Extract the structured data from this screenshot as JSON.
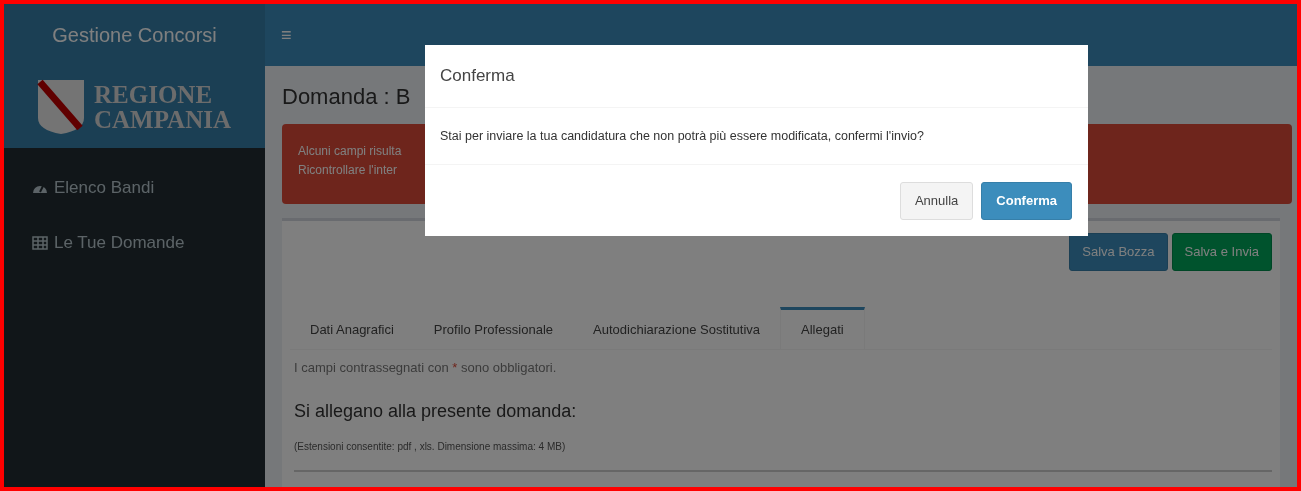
{
  "header": {
    "brand": "Gestione Concorsi",
    "menu_toggle": "≡"
  },
  "sidebar": {
    "logo_lines": [
      "REGIONE",
      "CAMPANIA"
    ],
    "items": [
      {
        "label": "Elenco Bandi",
        "kind": "dashboard",
        "selected": false
      },
      {
        "label": "Le Tue Domande",
        "kind": "table",
        "selected": false
      }
    ]
  },
  "page": {
    "title": "Domanda : B",
    "alert_lines": [
      "Alcuni campi risulta",
      "Ricontrollare l'inter"
    ],
    "actions": [
      {
        "label": "Salva Bozza",
        "kind": "primary"
      },
      {
        "label": "Salva e Invia",
        "kind": "success"
      }
    ],
    "tabs": [
      {
        "label": "Dati Anagrafici",
        "selected": false
      },
      {
        "label": "Profilo Professionale",
        "selected": false
      },
      {
        "label": "Autodichiarazione Sostitutiva",
        "selected": false
      },
      {
        "label": "Allegati",
        "selected": true
      }
    ],
    "required_note": {
      "before": "I campi contrassegnati con ",
      "mark": "*",
      "after": " sono obbligatori."
    },
    "section_title": "Si allegano alla presente domanda:",
    "hint": "(Estensioni consentite: pdf , xls. Dimensione massima: 4 MB)"
  },
  "modal": {
    "title": "Conferma",
    "message": "Stai per inviare la tua candidatura che non potrà più essere modificata, confermi l'invio?",
    "buttons": [
      {
        "label": "Annulla",
        "kind": "default"
      },
      {
        "label": "Conferma",
        "kind": "primary"
      }
    ]
  }
}
